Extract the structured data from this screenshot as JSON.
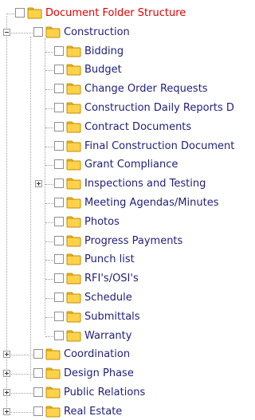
{
  "tree": {
    "root": {
      "label": "Document Folder Structure",
      "expanded": true,
      "checked": false
    },
    "nodes": [
      {
        "label": "Construction",
        "expanded": true,
        "checked": false,
        "children": [
          {
            "label": "Bidding",
            "checked": false,
            "has_children": false
          },
          {
            "label": "Budget",
            "checked": false,
            "has_children": false
          },
          {
            "label": "Change Order Requests",
            "checked": false,
            "has_children": false
          },
          {
            "label": "Construction Daily Reports D",
            "checked": false,
            "has_children": false
          },
          {
            "label": "Contract Documents",
            "checked": false,
            "has_children": false
          },
          {
            "label": "Final Construction Document",
            "checked": false,
            "has_children": false
          },
          {
            "label": "Grant Compliance",
            "checked": false,
            "has_children": false
          },
          {
            "label": "Inspections and Testing",
            "checked": false,
            "has_children": true,
            "expanded": false
          },
          {
            "label": "Meeting Agendas/Minutes",
            "checked": false,
            "has_children": false
          },
          {
            "label": "Photos",
            "checked": false,
            "has_children": false
          },
          {
            "label": "Progress Payments",
            "checked": false,
            "has_children": false
          },
          {
            "label": "Punch list",
            "checked": false,
            "has_children": false
          },
          {
            "label": "RFI's/OSI's",
            "checked": false,
            "has_children": false
          },
          {
            "label": "Schedule",
            "checked": false,
            "has_children": false
          },
          {
            "label": "Submittals",
            "checked": false,
            "has_children": false
          },
          {
            "label": "Warranty",
            "checked": false,
            "has_children": false
          }
        ]
      },
      {
        "label": "Coordination",
        "expanded": false,
        "checked": false,
        "children": []
      },
      {
        "label": "Design Phase",
        "expanded": false,
        "checked": false,
        "children": []
      },
      {
        "label": "Public Relations",
        "expanded": false,
        "checked": false,
        "children": []
      },
      {
        "label": "Real Estate",
        "expanded": false,
        "checked": false,
        "children": []
      }
    ]
  },
  "colors": {
    "root_label": "#e00000",
    "node_label": "#1f1f7a",
    "folder_fill": "#ffd24a",
    "folder_tab": "#f7c532",
    "folder_stroke": "#c08e00",
    "checkbox_border": "#8f8f8f",
    "connector": "#a0a0a0"
  },
  "icons": {
    "folder": "folder-icon",
    "expand": "expand-plus-icon",
    "collapse": "collapse-minus-icon"
  }
}
